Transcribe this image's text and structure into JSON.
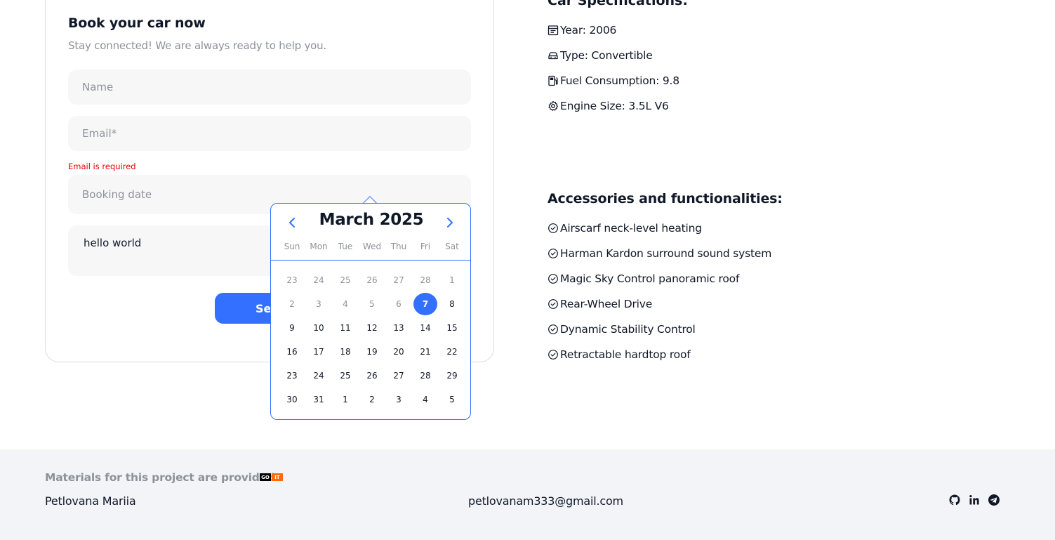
{
  "form": {
    "title": "Book your car now",
    "subtitle": "Stay connected! We are always ready to help you.",
    "name_placeholder": "Name",
    "email_placeholder": "Email*",
    "email_error": "Email is required",
    "date_placeholder": "Booking date",
    "comment_value": "hello world",
    "send_label": "Send"
  },
  "datepicker": {
    "title": "March 2025",
    "weekdays": [
      "Sun",
      "Mon",
      "Tue",
      "Wed",
      "Thu",
      "Fri",
      "Sat"
    ],
    "selected_day": "7",
    "days": [
      {
        "label": "23",
        "muted": true
      },
      {
        "label": "24",
        "muted": true
      },
      {
        "label": "25",
        "muted": true
      },
      {
        "label": "26",
        "muted": true
      },
      {
        "label": "27",
        "muted": true
      },
      {
        "label": "28",
        "muted": true
      },
      {
        "label": "1",
        "muted": true
      },
      {
        "label": "2",
        "muted": true
      },
      {
        "label": "3",
        "muted": true
      },
      {
        "label": "4",
        "muted": true
      },
      {
        "label": "5",
        "muted": true
      },
      {
        "label": "6",
        "muted": true
      },
      {
        "label": "7",
        "muted": false,
        "selected": true
      },
      {
        "label": "8",
        "muted": false
      },
      {
        "label": "9",
        "muted": false
      },
      {
        "label": "10",
        "muted": false
      },
      {
        "label": "11",
        "muted": false
      },
      {
        "label": "12",
        "muted": false
      },
      {
        "label": "13",
        "muted": false
      },
      {
        "label": "14",
        "muted": false
      },
      {
        "label": "15",
        "muted": false
      },
      {
        "label": "16",
        "muted": false
      },
      {
        "label": "17",
        "muted": false
      },
      {
        "label": "18",
        "muted": false
      },
      {
        "label": "19",
        "muted": false
      },
      {
        "label": "20",
        "muted": false
      },
      {
        "label": "21",
        "muted": false
      },
      {
        "label": "22",
        "muted": false
      },
      {
        "label": "23",
        "muted": false
      },
      {
        "label": "24",
        "muted": false
      },
      {
        "label": "25",
        "muted": false
      },
      {
        "label": "26",
        "muted": false
      },
      {
        "label": "27",
        "muted": false
      },
      {
        "label": "28",
        "muted": false
      },
      {
        "label": "29",
        "muted": false
      },
      {
        "label": "30",
        "muted": false
      },
      {
        "label": "31",
        "muted": false
      },
      {
        "label": "1",
        "muted": false
      },
      {
        "label": "2",
        "muted": false
      },
      {
        "label": "3",
        "muted": false
      },
      {
        "label": "4",
        "muted": false
      },
      {
        "label": "5",
        "muted": false
      }
    ]
  },
  "specs": {
    "heading": "Car Specifications:",
    "items": [
      {
        "icon": "calendar-icon",
        "text": "Year: 2006"
      },
      {
        "icon": "car-icon",
        "text": "Type: Convertible"
      },
      {
        "icon": "fuel-pump-icon",
        "text": "Fuel Consumption: 9.8"
      },
      {
        "icon": "gear-icon",
        "text": "Engine Size: 3.5L V6"
      }
    ]
  },
  "accessories": {
    "heading": "Accessories and functionalities:",
    "items": [
      "Airscarf neck-level heating",
      "Harman Kardon surround sound system",
      "Magic Sky Control panoramic roof",
      "Rear-Wheel Drive",
      "Dynamic Stability Control",
      "Retractable hardtop roof"
    ]
  },
  "footer": {
    "materials_label": "Materials for this project are provided:",
    "logo_left": "GO",
    "logo_right": "IT",
    "author": "Petlovana Mariia",
    "email": "petlovanam333@gmail.com",
    "social_icons": [
      "github-icon",
      "linkedin-icon",
      "telegram-icon"
    ]
  },
  "colors": {
    "accent": "#3470ff",
    "error": "#e00000",
    "muted_text": "#8d929a",
    "footer_bg": "#f2f4f7",
    "field_bg": "#f7f7f7"
  }
}
